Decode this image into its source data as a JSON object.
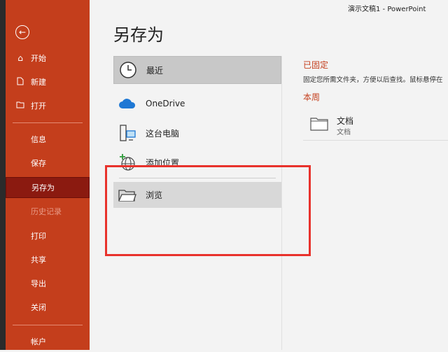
{
  "window": {
    "title": "演示文稿1  -  PowerPoint"
  },
  "page": {
    "heading": "另存为"
  },
  "colors": {
    "accent": "#c43e1c",
    "active_nav": "#8b1a10",
    "annotation": "#e8322c"
  },
  "sidebar": {
    "back_icon": "back-arrow-icon",
    "items": [
      {
        "label": "开始",
        "icon": "home-icon"
      },
      {
        "label": "新建",
        "icon": "new-file-icon"
      },
      {
        "label": "打开",
        "icon": "open-folder-icon"
      },
      {
        "label": "信息"
      },
      {
        "label": "保存"
      },
      {
        "label": "另存为",
        "selected": true
      },
      {
        "label": "历史记录",
        "disabled": true
      },
      {
        "label": "打印"
      },
      {
        "label": "共享"
      },
      {
        "label": "导出"
      },
      {
        "label": "关闭"
      },
      {
        "label": "帐户"
      }
    ]
  },
  "locations": [
    {
      "label": "最近",
      "icon": "clock-icon",
      "selected": true
    },
    {
      "label": "OneDrive",
      "icon": "cloud-icon"
    },
    {
      "label": "这台电脑",
      "icon": "computer-icon"
    },
    {
      "label": "添加位置",
      "icon": "add-globe-icon"
    },
    {
      "label": "浏览",
      "icon": "browse-folder-icon"
    }
  ],
  "pinned": {
    "title": "已固定",
    "description": "固定您所需文件夹，方便以后查找。鼠标悬停在"
  },
  "this_week": {
    "title": "本周",
    "items": [
      {
        "name": "文档",
        "path": "文档",
        "icon": "folder-icon"
      }
    ]
  }
}
